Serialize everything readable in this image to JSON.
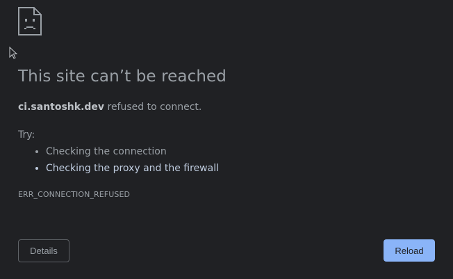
{
  "error_page": {
    "icon": "sad-page-icon",
    "title": "This site can’t be reached",
    "host": "ci.santoshk.dev",
    "refused_suffix": " refused to connect.",
    "try_label": "Try:",
    "suggestions": [
      "Checking the connection",
      "Checking the proxy and the firewall"
    ],
    "error_code": "ERR_CONNECTION_REFUSED",
    "details_label": "Details",
    "reload_label": "Reload"
  },
  "colors": {
    "background": "#202124",
    "text": "#9aa0a6",
    "link": "#bfccdf",
    "reload_button": "#8ab4f8"
  }
}
